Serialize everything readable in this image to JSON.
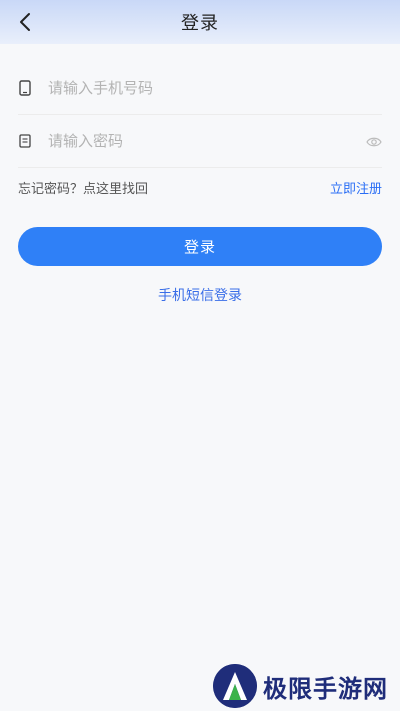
{
  "header": {
    "title": "登录",
    "back_icon": "chevron-left-icon"
  },
  "form": {
    "phone_placeholder": "请输入手机号码",
    "phone_icon": "phone-icon",
    "password_placeholder": "请输入密码",
    "password_icon": "lock-doc-icon",
    "eye_icon": "eye-icon"
  },
  "links": {
    "forgot": "忘记密码？点这里找回",
    "register": "立即注册"
  },
  "login_button": "登录",
  "sms_login": "手机短信登录",
  "watermark": {
    "text": "极限手游网"
  },
  "colors": {
    "accent": "#2f80f7",
    "link": "#2a6ef5",
    "header_gradient_top": "#c9d8f7",
    "watermark": "#1f2d7a"
  }
}
